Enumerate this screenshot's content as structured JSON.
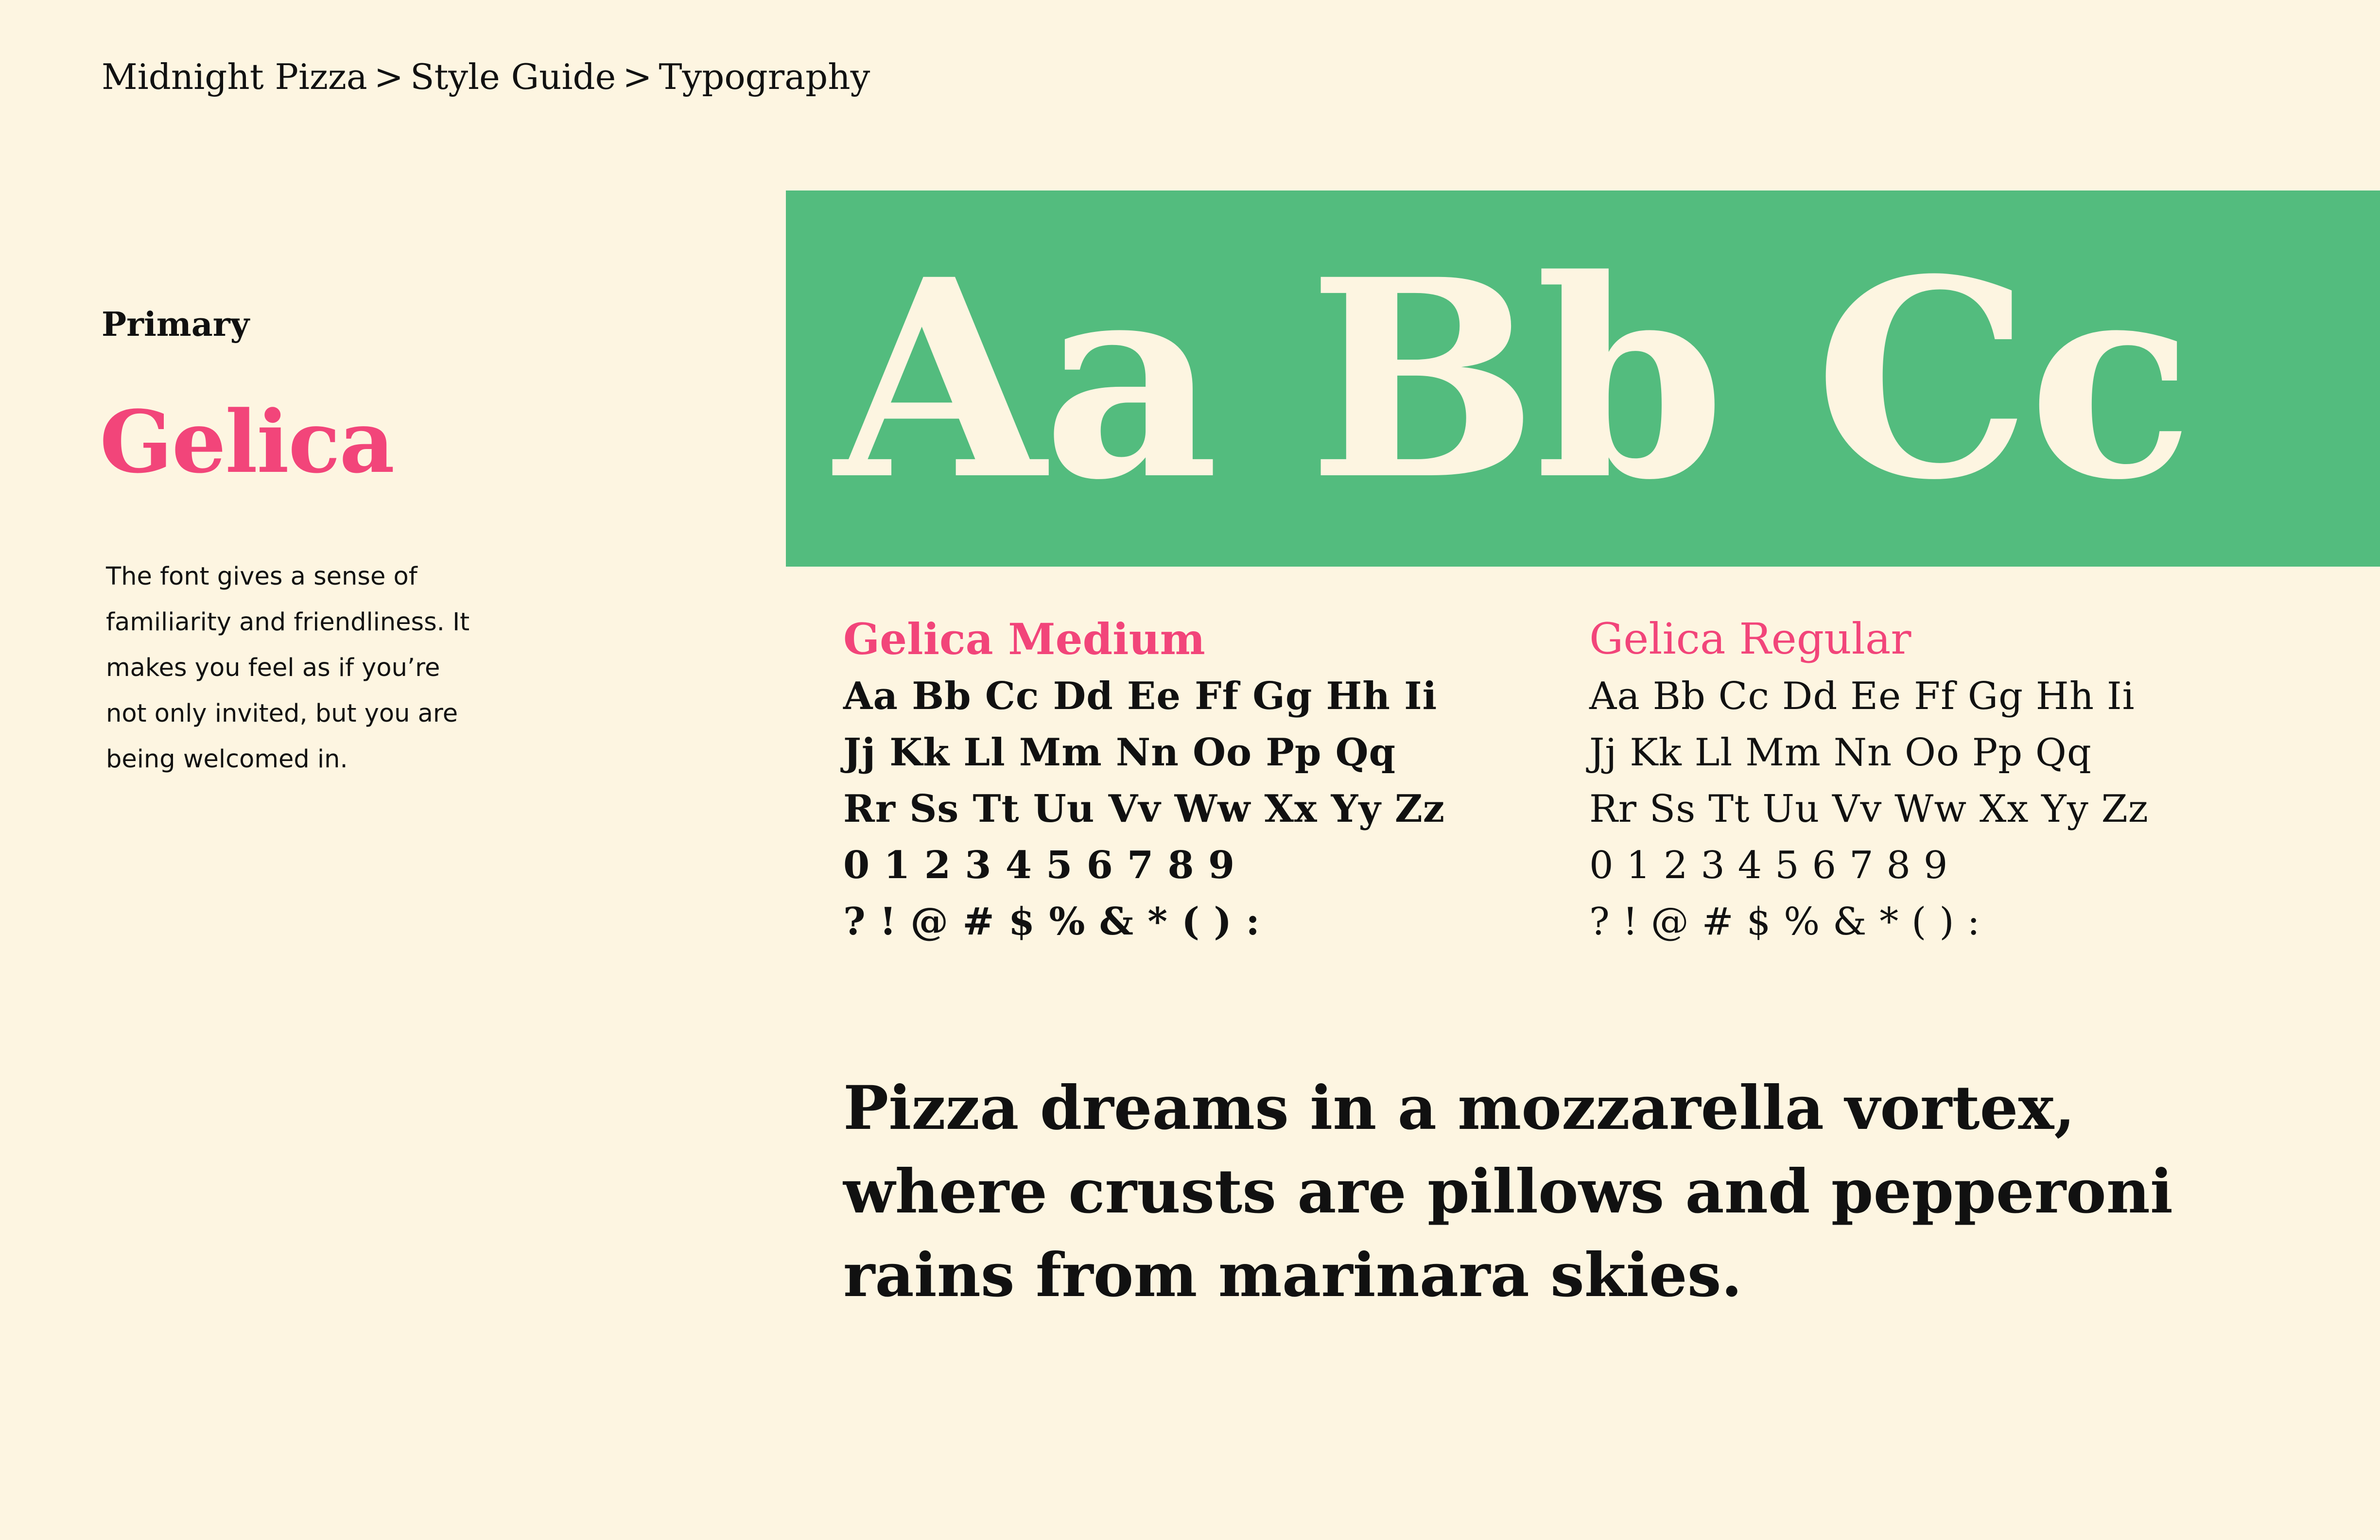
{
  "breadcrumb": {
    "items": [
      "Midnight Pizza",
      "Style Guide",
      "Typography"
    ],
    "separator": ">"
  },
  "sidebar": {
    "label": "Primary",
    "font_name": "Gelica",
    "description_lines": [
      "The font gives a sense of",
      "familiarity and friendliness. It",
      "makes you feel as if you’re",
      "not only invited, but you are",
      "being welcomed in."
    ]
  },
  "hero": {
    "text": "Aa Bb Cc"
  },
  "specimens": [
    {
      "title": "Gelica Medium",
      "lines": [
        "Aa Bb Cc Dd Ee Ff Gg Hh Ii",
        "Jj Kk Ll Mm Nn Oo Pp Qq",
        "Rr Ss Tt Uu Vv Ww Xx Yy Zz",
        "0 1 2 3 4 5 6 7 8 9",
        "? ! @ # $ % & * ( ) :"
      ]
    },
    {
      "title": "Gelica Regular",
      "lines": [
        "Aa Bb Cc Dd Ee Ff Gg Hh Ii",
        "Jj Kk Ll Mm Nn Oo Pp Qq",
        "Rr Ss Tt Uu Vv Ww Xx Yy Zz",
        "0 1 2 3 4 5 6 7 8 9",
        "? ! @ # $ % & * ( ) :"
      ]
    }
  ],
  "sample": {
    "lines": [
      "Pizza dreams in a mozzarella vortex,",
      "where crusts are pillows and pepperoni",
      "rains from marinara skies."
    ]
  },
  "colors": {
    "background": "#FDF5E1",
    "accent_pink": "#F2457A",
    "hero_green": "#53BC7E",
    "text_dark": "#111111"
  }
}
